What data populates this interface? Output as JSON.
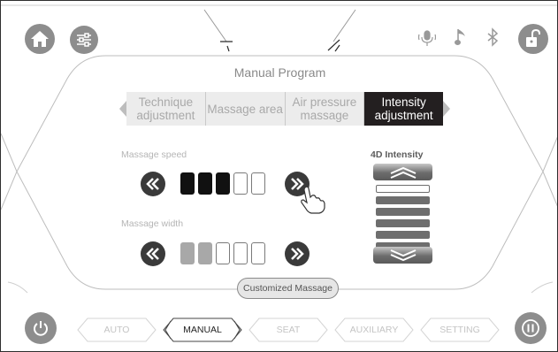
{
  "screen": {
    "title": "Manual Program",
    "tabs": [
      {
        "label": "Technique adjustment",
        "active": false
      },
      {
        "label": "Massage area",
        "active": false
      },
      {
        "label": "Air pressure massage",
        "active": false
      },
      {
        "label": "Intensity adjustment",
        "active": true
      }
    ]
  },
  "speed": {
    "label": "Massage speed",
    "level": 3,
    "max": 5
  },
  "width": {
    "label": "Massage width",
    "level": 2,
    "max": 5
  },
  "intensity": {
    "title": "4D Intensity",
    "level": 5,
    "max": 6
  },
  "customized_button": "Customized Massage",
  "bottom_nav": [
    {
      "label": "AUTO",
      "active": false
    },
    {
      "label": "MANUAL",
      "active": true
    },
    {
      "label": "SEAT",
      "active": false
    },
    {
      "label": "AUXILIARY",
      "active": false
    },
    {
      "label": "SETTING",
      "active": false
    }
  ],
  "icons": {
    "home": "home-icon",
    "settings": "sliders-icon",
    "voice": "microphone-icon",
    "music": "music-note-icon",
    "bluetooth": "bluetooth-icon",
    "lock": "unlock-icon",
    "power": "power-icon",
    "pause": "pause-icon",
    "pointer": "hand-pointer-icon"
  },
  "colors": {
    "accent_dark": "#231f20",
    "button_gray": "#8d8d8d",
    "inactive_text": "#a9a9a9"
  }
}
